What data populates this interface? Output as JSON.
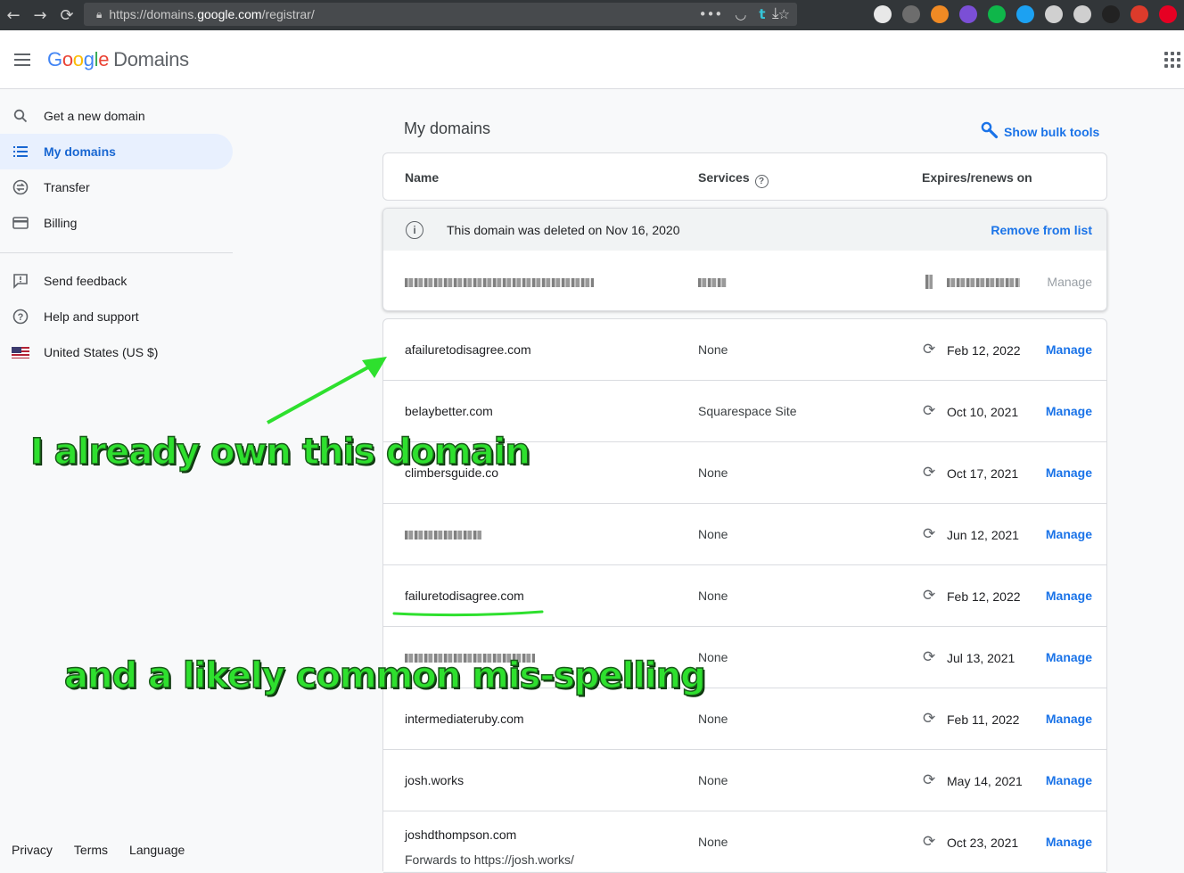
{
  "browser": {
    "url_prefix": "https://domains.",
    "url_host": "google.com",
    "url_suffix": "/registrar/",
    "nav": [
      "←",
      "→",
      "⟳"
    ],
    "ext_colors": [
      "#e8e8e8",
      "#6d6d6d",
      "#f08a24",
      "#7b4fd6",
      "#0fb64a",
      "#1ca1f2",
      "#d0d0d0",
      "#cfcfcf",
      "#222222",
      "#dd3b2b",
      "#e60023"
    ]
  },
  "app": {
    "logo_letters": [
      "G",
      "o",
      "o",
      "g",
      "l",
      "e"
    ],
    "product": "Domains"
  },
  "sidebar": {
    "items": [
      {
        "label": "Get a new domain",
        "icon": "⚲"
      },
      {
        "label": "My domains",
        "icon": "≡"
      },
      {
        "label": "Transfer",
        "icon": "⇄"
      },
      {
        "label": "Billing",
        "icon": "▭"
      },
      {
        "label": "Send feedback",
        "icon": "!"
      },
      {
        "label": "Help and support",
        "icon": "?"
      },
      {
        "label": "United States (US $)",
        "icon": ""
      }
    ],
    "footer": [
      "Privacy",
      "Terms",
      "Language"
    ]
  },
  "main": {
    "title": "My domains",
    "bulk_tools": "Show bulk tools",
    "columns": {
      "name": "Name",
      "services": "Services",
      "expires": "Expires/renews on"
    },
    "deleted": {
      "message": "This domain was deleted on Nov 16, 2020",
      "remove": "Remove from list",
      "manage": "Manage"
    },
    "renew_icon": "⟳",
    "rows": [
      {
        "name": "afailuretodisagree.com",
        "services": "None",
        "expires": "Feb 12, 2022",
        "manage": "Manage"
      },
      {
        "name": "belaybetter.com",
        "services": "Squarespace Site",
        "expires": "Oct 10, 2021",
        "manage": "Manage"
      },
      {
        "name": "climbersguide.co",
        "services": "None",
        "expires": "Oct 17, 2021",
        "manage": "Manage"
      },
      {
        "name": "",
        "services": "None",
        "expires": "Jun 12, 2021",
        "manage": "Manage"
      },
      {
        "name": "failuretodisagree.com",
        "services": "None",
        "expires": "Feb 12, 2022",
        "manage": "Manage"
      },
      {
        "name": "",
        "services": "None",
        "expires": "Jul 13, 2021",
        "manage": "Manage"
      },
      {
        "name": "intermediateruby.com",
        "services": "None",
        "expires": "Feb 11, 2022",
        "manage": "Manage"
      },
      {
        "name": "josh.works",
        "services": "None",
        "expires": "May 14, 2021",
        "manage": "Manage"
      },
      {
        "name": "joshdthompson.com",
        "services": "None",
        "expires": "Oct 23, 2021",
        "manage": "Manage",
        "sub": "Forwards to https://josh.works/"
      }
    ]
  },
  "annotations": {
    "one": "I already own this domain",
    "two": "and a likely common mis-spelling",
    "color": "#2ee02e"
  }
}
